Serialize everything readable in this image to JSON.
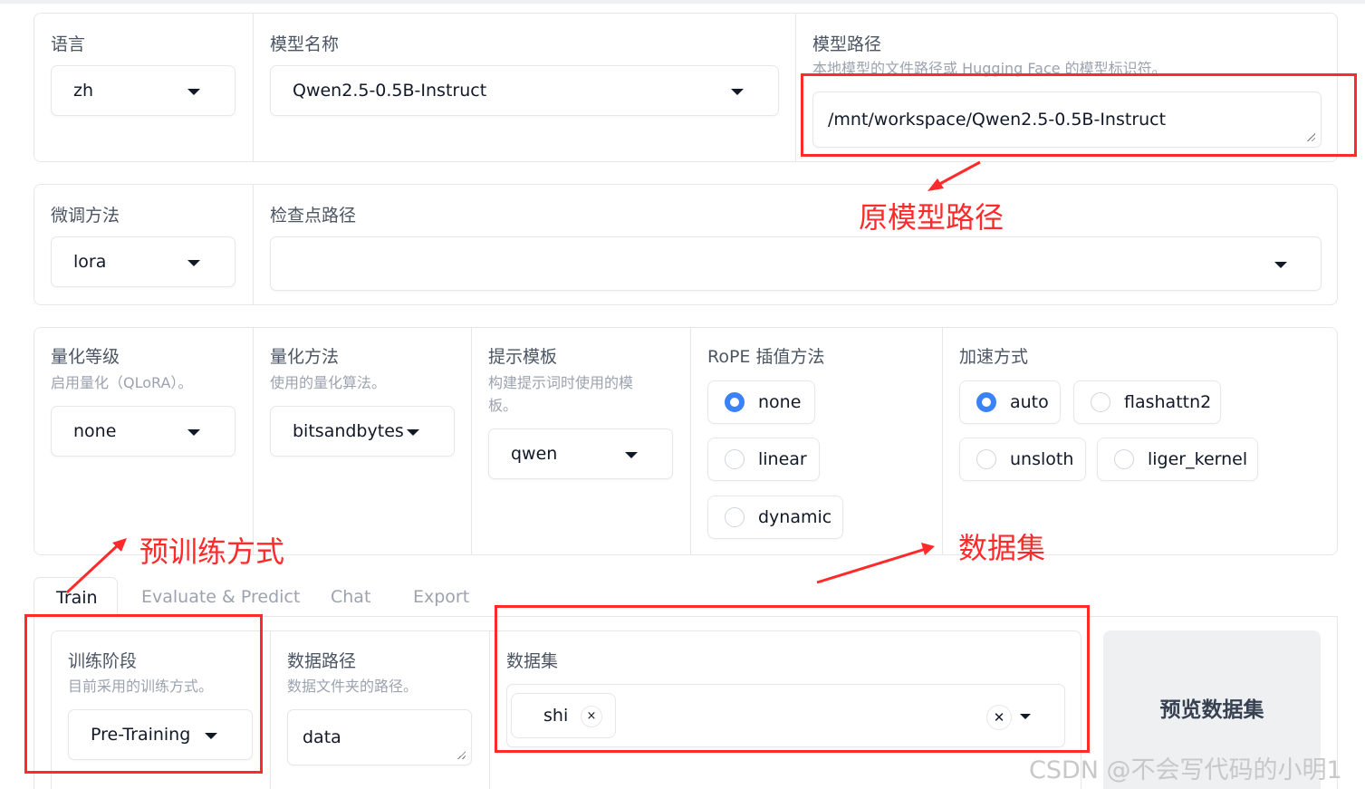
{
  "model_row": {
    "lang_label": "语言",
    "lang_value": "zh",
    "model_name_label": "模型名称",
    "model_name_value": "Qwen2.5-0.5B-Instruct",
    "model_path_label": "模型路径",
    "model_path_info": "本地模型的文件路径或 Hugging Face 的模型标识符。",
    "model_path_value": "/mnt/workspace/Qwen2.5-0.5B-Instruct"
  },
  "finetune_row": {
    "method_label": "微调方法",
    "method_value": "lora",
    "checkpoint_label": "检查点路径",
    "checkpoint_value": ""
  },
  "advanced_row": {
    "quant_bit_label": "量化等级",
    "quant_bit_info": "启用量化（QLoRA）。",
    "quant_bit_value": "none",
    "quant_method_label": "量化方法",
    "quant_method_info": "使用的量化算法。",
    "quant_method_value": "bitsandbytes",
    "template_label": "提示模板",
    "template_info": "构建提示词时使用的模板。",
    "template_value": "qwen",
    "rope_label": "RoPE 插值方法",
    "rope_options": [
      "none",
      "linear",
      "dynamic"
    ],
    "rope_selected": "none",
    "booster_label": "加速方式",
    "booster_options": [
      "auto",
      "flashattn2",
      "unsloth",
      "liger_kernel"
    ],
    "booster_selected": "auto"
  },
  "tabs": [
    "Train",
    "Evaluate & Predict",
    "Chat",
    "Export"
  ],
  "active_tab": "Train",
  "train": {
    "stage_label": "训练阶段",
    "stage_info": "目前采用的训练方式。",
    "stage_value": "Pre-Training",
    "dataset_dir_label": "数据路径",
    "dataset_dir_info": "数据文件夹的路径。",
    "dataset_dir_value": "data",
    "dataset_label": "数据集",
    "dataset_chip": "shi",
    "chip_remove": "×",
    "clear_symbol": "✕",
    "preview_button": "预览数据集"
  },
  "annotations": {
    "model_path": "原模型路径",
    "train_method": "预训练方式",
    "dataset": "数据集",
    "color": "#ff2a2a"
  },
  "watermark": "CSDN @不会写代码的小明1",
  "colors": {
    "accent": "#3b82f6",
    "border": "#e5e7eb",
    "button_bg": "#eff0f2"
  }
}
